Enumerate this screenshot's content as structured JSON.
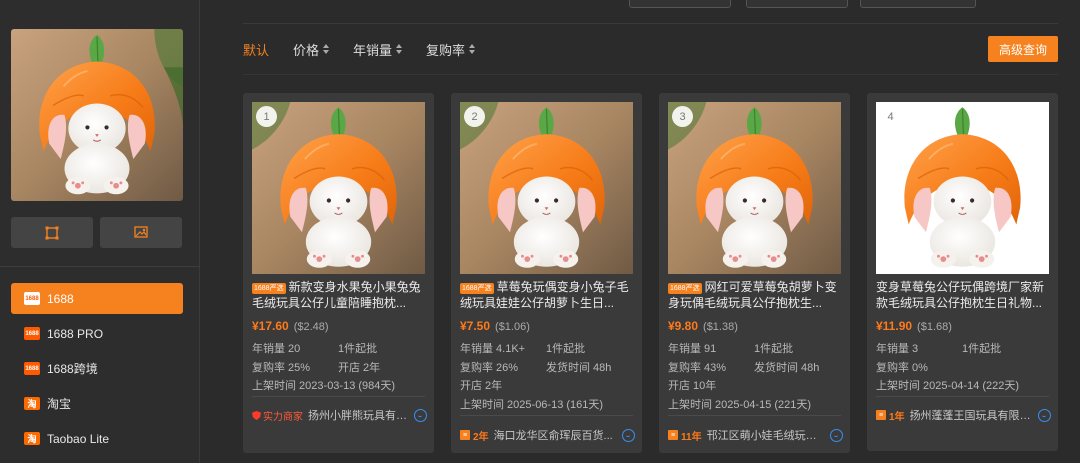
{
  "sidebar": {
    "nav": [
      {
        "label": "1688",
        "logo": "1688",
        "active": true
      },
      {
        "label": "1688 PRO",
        "logo": "1688",
        "active": false
      },
      {
        "label": "1688跨境",
        "logo": "1688",
        "active": false
      },
      {
        "label": "淘宝",
        "logo": "淘",
        "active": false
      },
      {
        "label": "Taobao Lite",
        "logo": "淘",
        "active": false
      }
    ],
    "tools": [
      {
        "icon": "crop-frame-icon"
      },
      {
        "icon": "image-search-icon"
      }
    ]
  },
  "sort_bar": {
    "items": [
      "默认",
      "价格",
      "年销量",
      "复购率"
    ],
    "active": "默认",
    "advanced_label": "高级查询"
  },
  "colors": {
    "accent": "#f5821f",
    "price": "#ff7a1a",
    "link": "#3b8ff0"
  },
  "cards": [
    {
      "rank": "1",
      "badge": "1688严选",
      "title": "新款变身水果兔小果兔兔毛绒玩具公仔儿童陪睡抱枕...",
      "price": "¥17.60",
      "usd": "($2.48)",
      "annual_sales": "年销量 20",
      "moq": "1件起批",
      "repurchase": "复购率 25%",
      "shop_age": "开店 2年",
      "listed": "上架时间 2023-03-13 (984天)",
      "shop_badge": "实力商家",
      "shop_name": "扬州小胖熊玩具有限..."
    },
    {
      "rank": "2",
      "badge": "1688严选",
      "title": "草莓兔玩偶变身小兔子毛绒玩具娃娃公仔胡萝卜生日...",
      "price": "¥7.50",
      "usd": "($1.06)",
      "annual_sales": "年销量 4.1K+",
      "moq": "1件起批",
      "repurchase": "复购率 26%",
      "ship": "发货时间 48h",
      "shop_age": "开店 2年",
      "listed": "上架时间 2025-06-13 (161天)",
      "shop_badge": "2年",
      "shop_name": "海口龙华区俞珲辰百货..."
    },
    {
      "rank": "3",
      "badge": "1688严选",
      "title": "网红可爱草莓兔胡萝卜变身玩偶毛绒玩具公仔抱枕生...",
      "price": "¥9.80",
      "usd": "($1.38)",
      "annual_sales": "年销量 91",
      "moq": "1件起批",
      "repurchase": "复购率 43%",
      "ship": "发货时间 48h",
      "shop_age": "开店 10年",
      "listed": "上架时间 2025-04-15 (221天)",
      "shop_badge": "11年",
      "shop_name": "邗江区萌小娃毛绒玩具..."
    },
    {
      "rank": "4",
      "title": "变身草莓兔公仔玩偶跨境厂家新款毛绒玩具公仔抱枕生日礼物...",
      "price": "¥11.90",
      "usd": "($1.68)",
      "annual_sales": "年销量 3",
      "moq": "1件起批",
      "repurchase": "复购率 0%",
      "listed": "上架时间 2025-04-14 (222天)",
      "shop_badge": "1年",
      "shop_name": "扬州蓬蓬王国玩具有限公..."
    }
  ]
}
